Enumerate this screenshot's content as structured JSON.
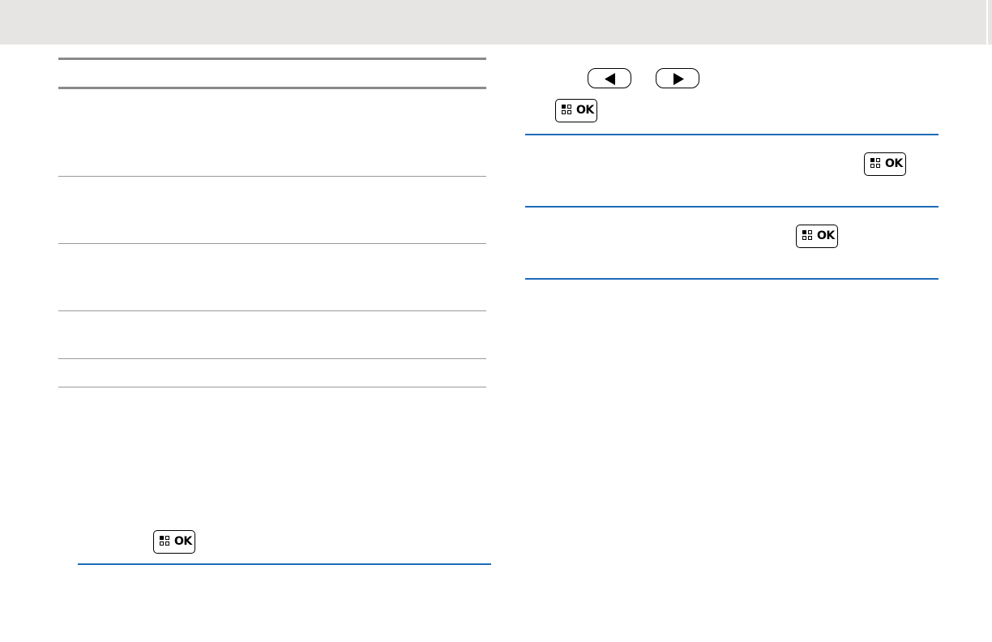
{
  "header": {
    "background": "#e6e5e3"
  },
  "colors": {
    "rule_gray": "#9a9a9a",
    "rule_blue": "#1c6bb8"
  },
  "keys": {
    "menu_ok": {
      "icon": "menu-ok-key-icon",
      "label": "OK"
    },
    "left": {
      "icon": "left-arrow-key-icon"
    },
    "right": {
      "icon": "right-arrow-key-icon"
    }
  }
}
